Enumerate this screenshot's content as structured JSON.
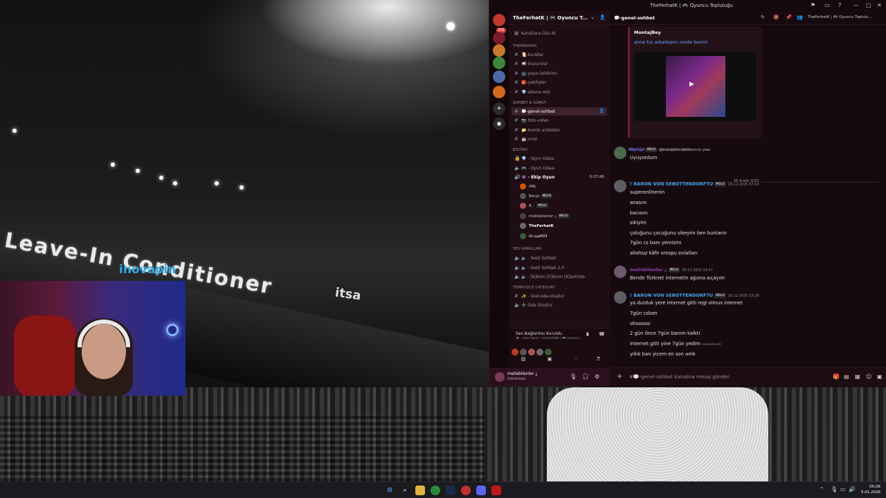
{
  "background": {
    "ad_text": "Leave-In Conditioner",
    "ad_logo": "inovapin",
    "ad_its": "itsa"
  },
  "window": {
    "title": "TheFerhatK | 🎮 Oyuncu Topluluğu",
    "controls": [
      "—",
      "□",
      "✕"
    ]
  },
  "guilds": {
    "badge": "239"
  },
  "server": {
    "name": "TheFerhatK | 🎮 Oyuncu T...",
    "browse_channels": "Kanallara Göz At"
  },
  "categories": {
    "theferhatk": "THEFERHATK",
    "sohbet": "SOHBET & KOMUT",
    "bizziko": "BİZZİKO",
    "ses": "SES KANALLARI",
    "tempvoice": "TEMPVOICE CATEGORY"
  },
  "channels": {
    "kurallar": "📜-kurallar",
    "duyurular": "📢-duyurular",
    "yayin": "📺-yayın-bildirimi",
    "cekilisler": "🎁-çekilişler",
    "abone": "💎-abone-rolü",
    "genel": "💬-genel-sohbet",
    "foto": "📷-foto-video",
    "komik": "📁-komik-anlardan",
    "cmd": "🤖-cmd",
    "yayin_odasi": "💎 - Yayın Odası",
    "oyun_odasi": "🎮 - Oyun Odası",
    "ekip_oyun": "👾 - Ekip Oyun",
    "ekip_timer": "5:17:45",
    "sesli_sohbet": "🔈 - Sesli Sohbet",
    "sesli_sohbet2": "🔈 - Sesli Sohbet 2.0",
    "aklim": "🔈 - [A]klım [F]ikrim [K]antirda",
    "ozel_oda": "✨ - özel-oda-oluştur",
    "oda_olustur": "➕ Oda Oluştur"
  },
  "voice_users": [
    {
      "name": "ANL",
      "tag": ""
    },
    {
      "name": "Benjo",
      "tag": "MELO"
    },
    {
      "name": "B...",
      "tag": "MELO"
    },
    {
      "name": "melisbilenler ¿",
      "tag": "MELO"
    },
    {
      "name": "TheFerhatK",
      "tag": ""
    },
    {
      "name": "OrムaН03",
      "tag": ""
    }
  ],
  "voice_panel": {
    "status": "Ses Bağlantısı Kuruldu",
    "sub": "👾 - Ekip Oyun / TheFerhatK | 🎮 Oyuncu..."
  },
  "user_panel": {
    "name": "melisbilenler ¿",
    "status": "Görünmez"
  },
  "chat": {
    "channel_name": "💬-genel-sohbet",
    "header_server": "TheFerhatK | 🎮 Oyuncu Toplulu...",
    "embed_author": "MontajBey",
    "embed_title": "anne kız arkadaşım nerde benim",
    "reply_name": "@TheFerhatK",
    "reply_text": "@everyone nerdesiniz yaw",
    "date_divider": "26 Aralık 2025",
    "placeholder": "#💬-genel-sohbet kanalına mesaj gönder",
    "messages": [
      {
        "user": "Benjo",
        "tag": "MELO",
        "time": "22.12.2025 18:50",
        "color": "#5865f2",
        "lines": [
          "Uyuyordum"
        ]
      },
      {
        "user": "! BARON VON SEBOTTENDORFTU",
        "tag": "MELO",
        "time": "26.12.2025 07:14",
        "color": "#3fa9f5",
        "lines": [
          "superonlinenin",
          "anasını",
          "bacısını",
          "sikiyim",
          "çoluğunu çocuğunu sikeyim ben bunların",
          "7gün cs banı yemisim",
          "allahsız kâfir orospu evlatları"
        ]
      },
      {
        "user": "melisbilenler ¿",
        "tag": "MELO",
        "time": "26.12.2025 19:27",
        "color": "#8e44ad",
        "lines": [
          "Bende Türknet internetin ağızna sıçayım"
        ]
      },
      {
        "user": "! BARON VON SEBOTTENDORFTU",
        "tag": "MELO",
        "time": "26.12.2025 19:28",
        "color": "#3fa9f5",
        "lines": [
          "ya durduk yere internet gitti regl olmus internet",
          "7gün csban",
          "ohooooo",
          "2 gün önce 7gün banım kalktı",
          "internet gitti yine 7gün yedim",
          "yıllık ban yicem en son amk"
        ]
      }
    ],
    "edited_label": "(düzenlendi)"
  },
  "taskbar": {
    "time": "05:06",
    "date": "5.01.2026"
  }
}
